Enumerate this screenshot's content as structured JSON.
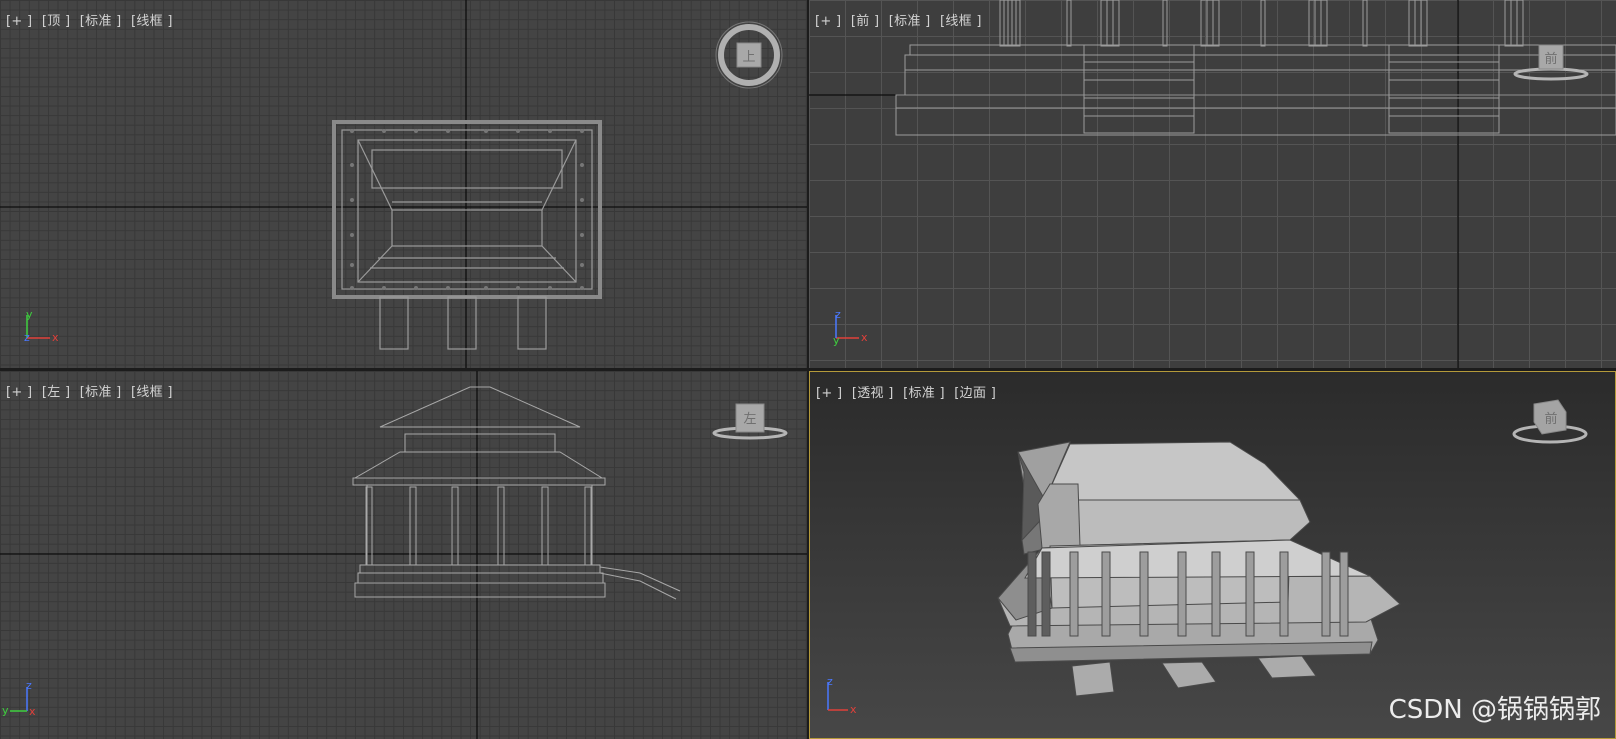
{
  "viewports": {
    "top": {
      "labels": [
        "+",
        "顶",
        "标准",
        "线框"
      ],
      "gizmo_label": "上"
    },
    "front": {
      "labels": [
        "+",
        "前",
        "标准",
        "线框"
      ],
      "gizmo_label": "前"
    },
    "left": {
      "labels": [
        "+",
        "左",
        "标准",
        "线框"
      ],
      "gizmo_label": "左"
    },
    "perspective": {
      "labels": [
        "+",
        "透视",
        "标准",
        "边面"
      ],
      "gizmo_label": "前"
    }
  },
  "axes": {
    "top": [
      "y",
      "x",
      "z"
    ],
    "front": [
      "z",
      "x",
      "y"
    ],
    "left": [
      "z",
      "y",
      "x"
    ],
    "perspective": [
      "z",
      "x"
    ]
  },
  "watermark": "CSDN @锅锅锅郭",
  "colors": {
    "active_border": "#b49a3a",
    "axis_x": "#e0403a",
    "axis_y": "#3ed03e",
    "axis_z": "#4a78ff"
  }
}
